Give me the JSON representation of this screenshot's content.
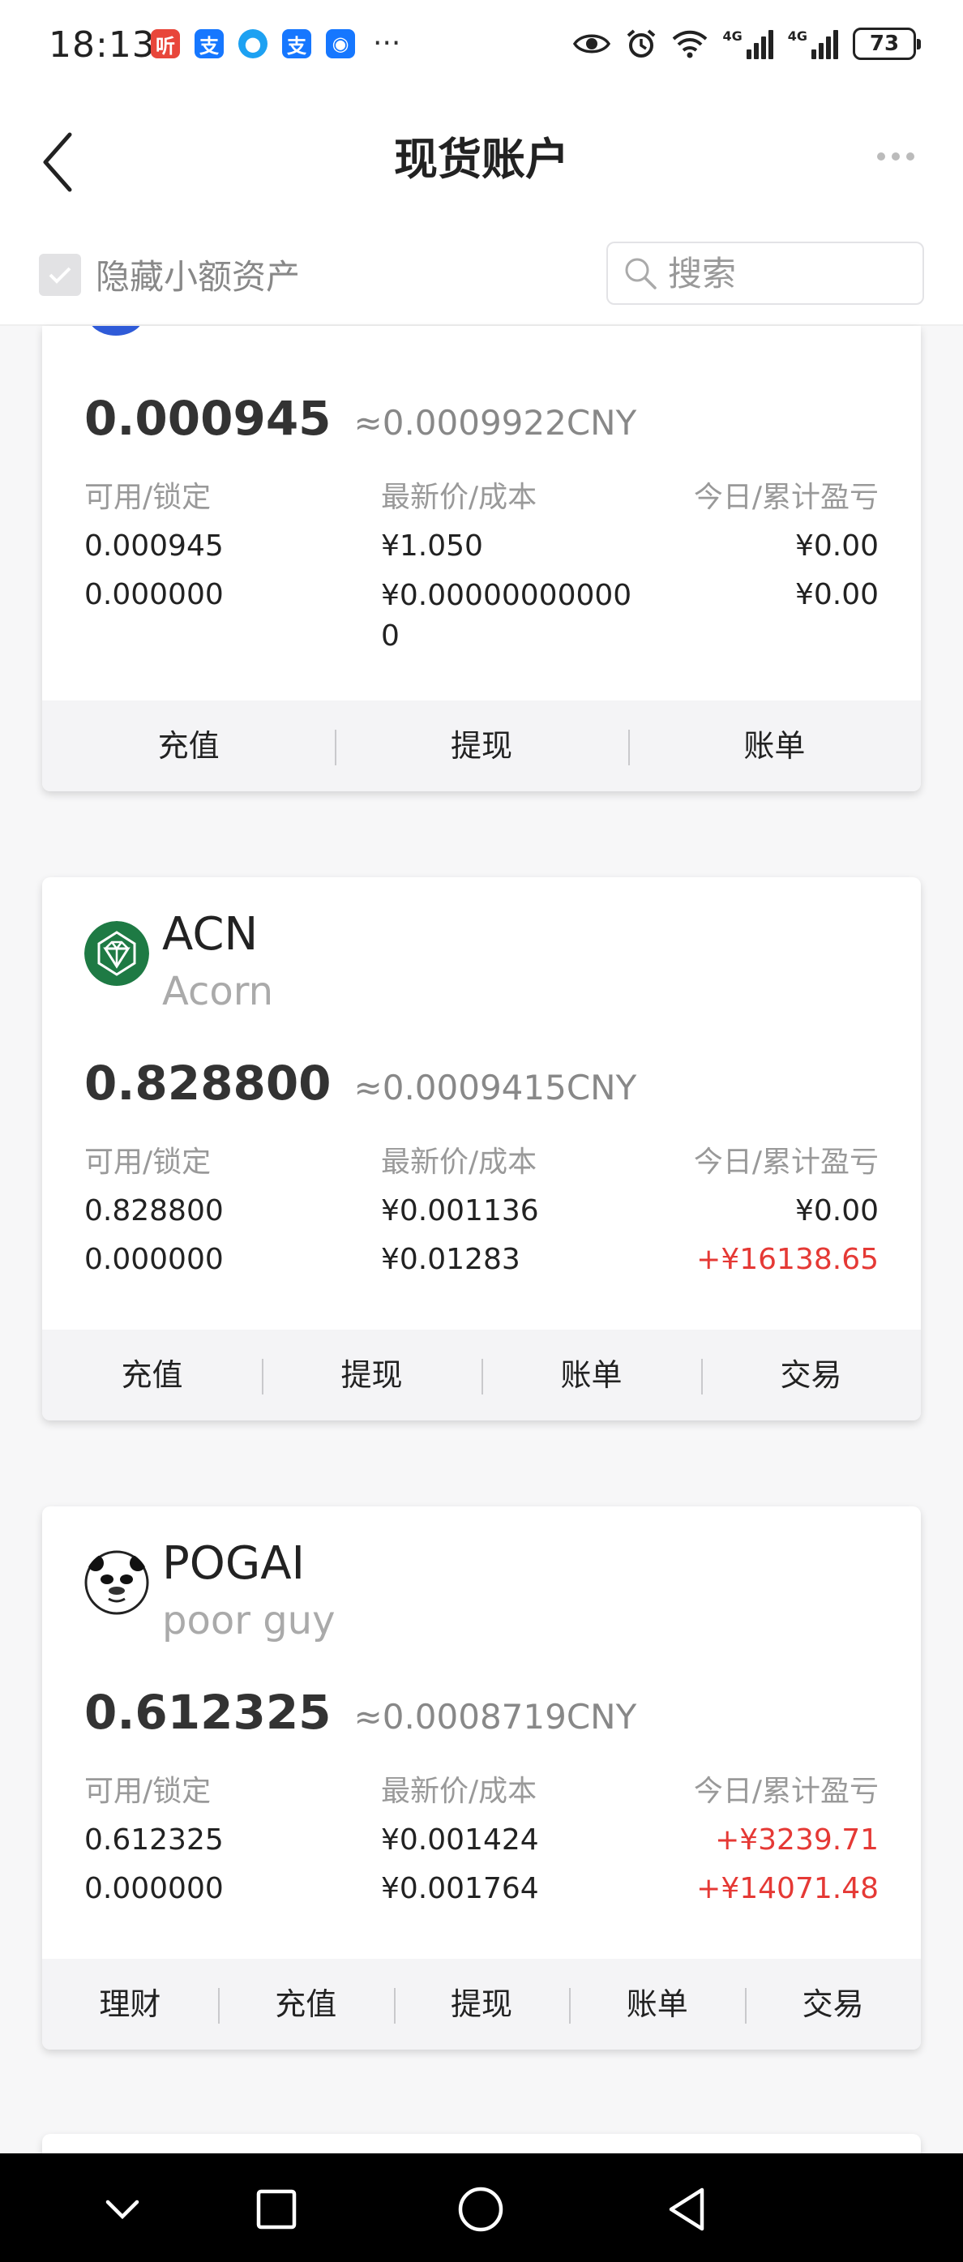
{
  "status_bar": {
    "time": "18:13",
    "app_badges": [
      {
        "icon": "ting-app-icon",
        "text": "听",
        "color": "#e8463a"
      },
      {
        "icon": "alipay-icon",
        "text": "支",
        "color": "#1677ff"
      },
      {
        "icon": "blue-app-icon",
        "text": "●",
        "color": "#1da1f2"
      },
      {
        "icon": "alipay-icon",
        "text": "支",
        "color": "#1677ff"
      },
      {
        "icon": "bulb-app-icon",
        "text": "◉",
        "color": "#1677ff"
      }
    ],
    "more": "···",
    "signal_1": "4G",
    "signal_2": "4G",
    "battery": "73"
  },
  "header": {
    "title": "现货账户"
  },
  "filter": {
    "hide_small_label": "隐藏小额资产",
    "search_placeholder": "搜索"
  },
  "labels": {
    "available_locked": "可用/锁定",
    "price_cost": "最新价/成本",
    "pnl": "今日/累计盈亏"
  },
  "cards": [
    {
      "amount": "0.000945",
      "approx": "≈0.0009922CNY",
      "available": "0.000945",
      "locked": "0.000000",
      "latest_price": "¥1.050",
      "cost": "¥0.000000000000",
      "today_pnl": "¥0.00",
      "total_pnl": "¥0.00",
      "actions": [
        "充值",
        "提现",
        "账单"
      ]
    },
    {
      "symbol": "ACN",
      "name": "Acorn",
      "amount": "0.828800",
      "approx": "≈0.0009415CNY",
      "available": "0.828800",
      "locked": "0.000000",
      "latest_price": "¥0.001136",
      "cost": "¥0.01283",
      "today_pnl": "¥0.00",
      "total_pnl": "+¥16138.65",
      "actions": [
        "充值",
        "提现",
        "账单",
        "交易"
      ]
    },
    {
      "symbol": "POGAI",
      "name": "poor guy",
      "amount": "0.612325",
      "approx": "≈0.0008719CNY",
      "available": "0.612325",
      "locked": "0.000000",
      "latest_price": "¥0.001424",
      "cost": "¥0.001764",
      "today_pnl": "+¥3239.71",
      "total_pnl": "+¥14071.48",
      "actions": [
        "理财",
        "充值",
        "提现",
        "账单",
        "交易"
      ]
    }
  ],
  "colors": {
    "positive": "#e53935",
    "acn_logo": "#1e7a44"
  }
}
